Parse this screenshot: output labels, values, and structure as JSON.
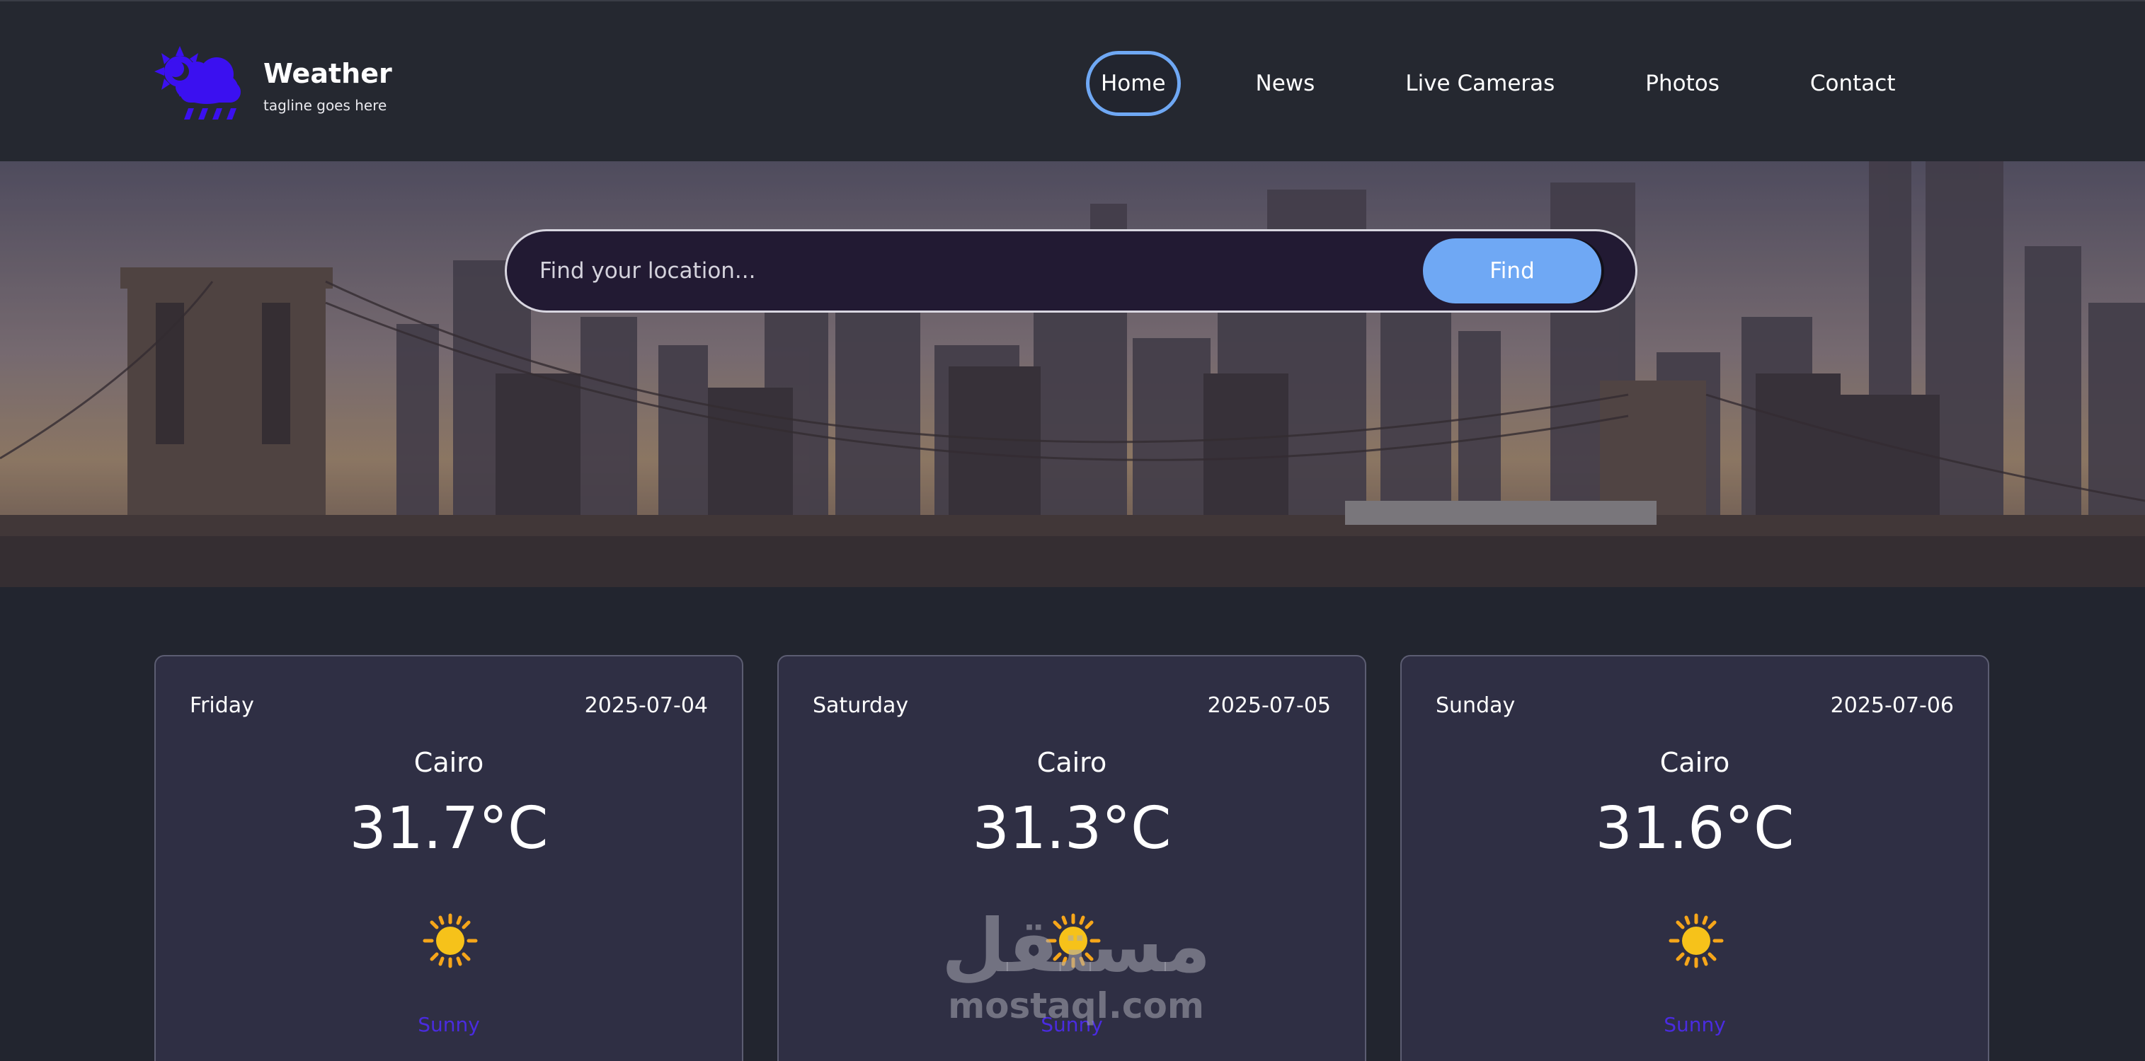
{
  "brand": {
    "title": "Weather",
    "tagline": "tagline goes here",
    "icon": "sun-cloud-rain-icon"
  },
  "nav": {
    "items": [
      {
        "label": "Home",
        "active": true
      },
      {
        "label": "News",
        "active": false
      },
      {
        "label": "Live Cameras",
        "active": false
      },
      {
        "label": "Photos",
        "active": false
      },
      {
        "label": "Contact",
        "active": false
      }
    ]
  },
  "search": {
    "placeholder": "Find your location...",
    "value": "",
    "button_label": "Find"
  },
  "forecast": [
    {
      "day": "Friday",
      "date": "2025-07-04",
      "city": "Cairo",
      "temp": "31.7°C",
      "icon": "sun-icon",
      "condition": "Sunny"
    },
    {
      "day": "Saturday",
      "date": "2025-07-05",
      "city": "Cairo",
      "temp": "31.3°C",
      "icon": "sun-icon",
      "condition": "Sunny"
    },
    {
      "day": "Sunday",
      "date": "2025-07-06",
      "city": "Cairo",
      "temp": "31.6°C",
      "icon": "sun-icon",
      "condition": "Sunny"
    }
  ],
  "watermark": {
    "arabic": "مستقل",
    "latin": "mostaql.com"
  },
  "colors": {
    "background": "#22252f",
    "header": "#252830",
    "accent": "#6fa8f4",
    "brand_icon": "#3b10f0",
    "card": "#2f2f44",
    "condition_text": "#4a2be0",
    "sun": "#f6c21a"
  }
}
